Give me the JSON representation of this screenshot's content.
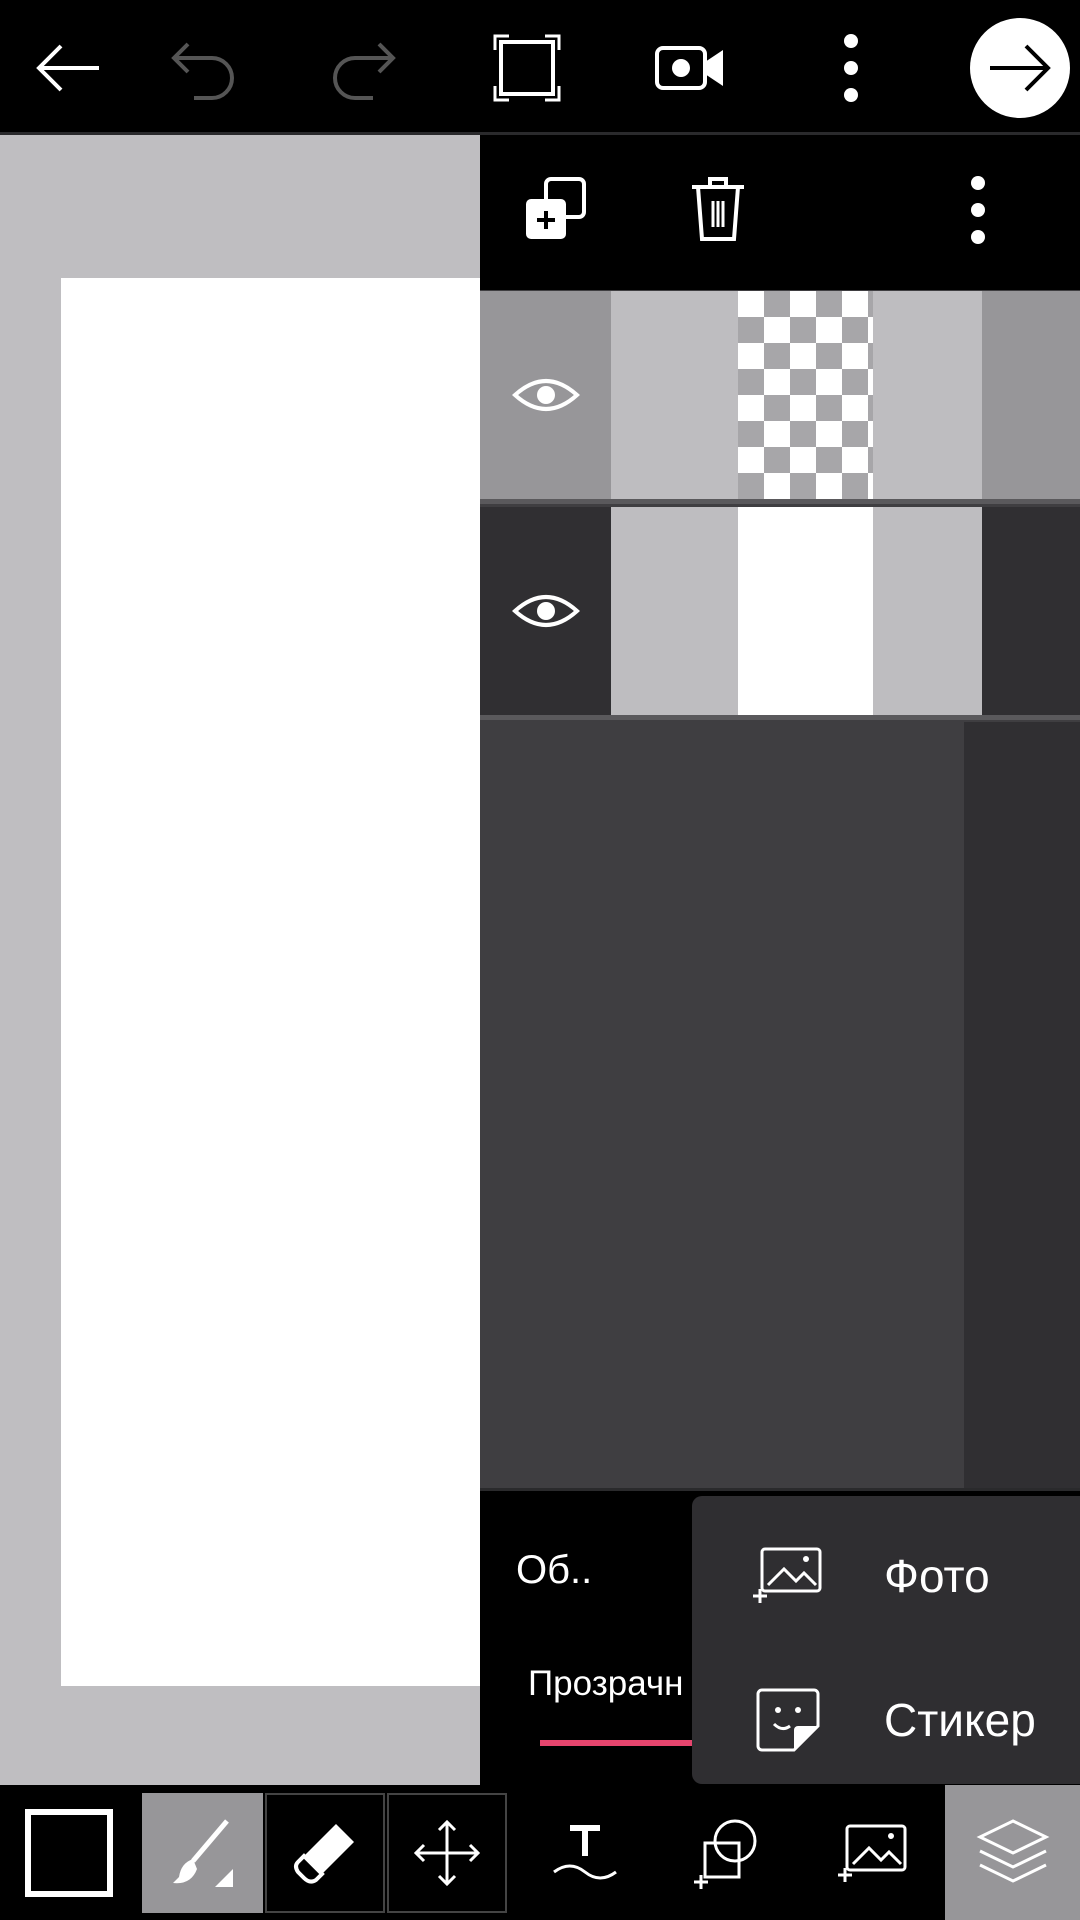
{
  "toolbar": {
    "back_icon": "arrow-left-icon",
    "undo_icon": "undo-icon",
    "redo_icon": "redo-icon",
    "fullscreen_icon": "fullscreen-icon",
    "record_icon": "video-camera-icon",
    "more_icon": "more-vertical-icon",
    "next_icon": "arrow-right-icon"
  },
  "layers_panel": {
    "toolbar_icons": [
      "add-layer-icon",
      "trash-icon",
      "more-vertical-icon"
    ],
    "layers": [
      {
        "visible": true,
        "thumbnail": "transparent",
        "selected": true
      },
      {
        "visible": true,
        "thumbnail": "white",
        "selected": false
      }
    ],
    "blend_mode_label": "Об..",
    "opacity_label": "Прозрачн"
  },
  "add_menu": {
    "items": [
      {
        "label": "Фото",
        "icon": "add-photo-icon"
      },
      {
        "label": "Стикер",
        "icon": "sticker-icon"
      }
    ]
  },
  "bottom_toolbar": {
    "tools": [
      "color-swatch",
      "brush-icon",
      "eraser-icon",
      "move-icon",
      "text-icon",
      "shape-icon",
      "add-image-icon",
      "layers-icon"
    ],
    "active_color": "#000000",
    "accent_color": "#e6456e"
  }
}
